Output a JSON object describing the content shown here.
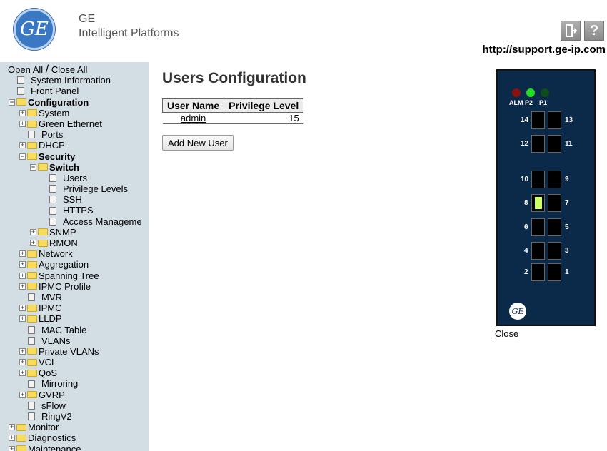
{
  "header": {
    "logo_text": "GE",
    "brand_line1": "GE",
    "brand_line2": "Intelligent Platforms",
    "logout_icon": "exit-door-icon",
    "help_icon_text": "?",
    "support_url": "http://support.ge-ip.com"
  },
  "sidebar": {
    "open_all": "Open All",
    "separator": "/",
    "close_all": "Close All",
    "items": [
      {
        "label": "System Information",
        "indent": 1,
        "type": "page"
      },
      {
        "label": "Front Panel",
        "indent": 1,
        "type": "page"
      },
      {
        "label": "Configuration",
        "indent": 1,
        "type": "folder-open",
        "bold": true
      },
      {
        "label": "System",
        "indent": 2,
        "type": "folder"
      },
      {
        "label": "Green Ethernet",
        "indent": 2,
        "type": "folder"
      },
      {
        "label": "Ports",
        "indent": 2,
        "type": "page"
      },
      {
        "label": "DHCP",
        "indent": 2,
        "type": "folder"
      },
      {
        "label": "Security",
        "indent": 2,
        "type": "folder-open",
        "bold": true
      },
      {
        "label": "Switch",
        "indent": 3,
        "type": "folder-open",
        "bold": true
      },
      {
        "label": "Users",
        "indent": 4,
        "type": "page"
      },
      {
        "label": "Privilege Levels",
        "indent": 4,
        "type": "page"
      },
      {
        "label": "SSH",
        "indent": 4,
        "type": "page"
      },
      {
        "label": "HTTPS",
        "indent": 4,
        "type": "page"
      },
      {
        "label": "Access Manageme",
        "indent": 4,
        "type": "page"
      },
      {
        "label": "SNMP",
        "indent": 3,
        "type": "folder"
      },
      {
        "label": "RMON",
        "indent": 3,
        "type": "folder"
      },
      {
        "label": "Network",
        "indent": 2,
        "type": "folder"
      },
      {
        "label": "Aggregation",
        "indent": 2,
        "type": "folder"
      },
      {
        "label": "Spanning Tree",
        "indent": 2,
        "type": "folder"
      },
      {
        "label": "IPMC Profile",
        "indent": 2,
        "type": "folder"
      },
      {
        "label": "MVR",
        "indent": 2,
        "type": "page"
      },
      {
        "label": "IPMC",
        "indent": 2,
        "type": "folder"
      },
      {
        "label": "LLDP",
        "indent": 2,
        "type": "folder"
      },
      {
        "label": "MAC Table",
        "indent": 2,
        "type": "page"
      },
      {
        "label": "VLANs",
        "indent": 2,
        "type": "page"
      },
      {
        "label": "Private VLANs",
        "indent": 2,
        "type": "folder"
      },
      {
        "label": "VCL",
        "indent": 2,
        "type": "folder"
      },
      {
        "label": "QoS",
        "indent": 2,
        "type": "folder"
      },
      {
        "label": "Mirroring",
        "indent": 2,
        "type": "page"
      },
      {
        "label": "GVRP",
        "indent": 2,
        "type": "folder"
      },
      {
        "label": "sFlow",
        "indent": 2,
        "type": "page"
      },
      {
        "label": "RingV2",
        "indent": 2,
        "type": "page"
      },
      {
        "label": "Monitor",
        "indent": 1,
        "type": "folder"
      },
      {
        "label": "Diagnostics",
        "indent": 1,
        "type": "folder"
      },
      {
        "label": "Maintenance",
        "indent": 1,
        "type": "folder"
      }
    ]
  },
  "main": {
    "title": "Users Configuration",
    "table": {
      "headers": [
        "User Name",
        "Privilege Level"
      ],
      "rows": [
        {
          "user": "admin",
          "level": "15"
        }
      ]
    },
    "add_button": "Add New User"
  },
  "device": {
    "leds": [
      {
        "label": "ALM",
        "color": "#8b1010"
      },
      {
        "label": "P2",
        "color": "#22dd22"
      },
      {
        "label": "P1",
        "color": "#0d4d1a"
      }
    ],
    "ports": [
      "14",
      "13",
      "12",
      "11",
      "10",
      "9",
      "8",
      "7",
      "6",
      "5",
      "4",
      "3",
      "2",
      "1"
    ],
    "active_port": "8",
    "active_color": "#ccff66",
    "close_label": "Close"
  }
}
